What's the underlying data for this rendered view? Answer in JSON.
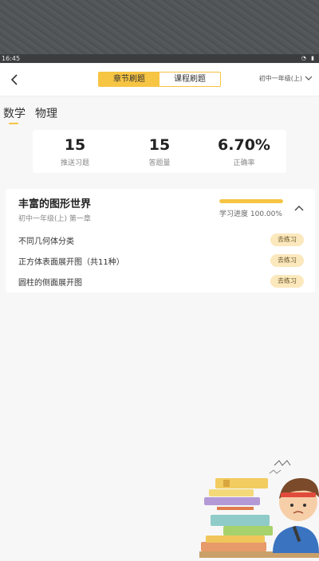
{
  "status_bar": {
    "time": "16:45",
    "icons": [
      "wifi-icon",
      "battery-icon"
    ]
  },
  "nav": {
    "tabs": [
      {
        "label": "章节刷题",
        "active": true
      },
      {
        "label": "课程刷题",
        "active": false
      }
    ],
    "grade_selector": "初中一年级(上)"
  },
  "subjects": [
    {
      "label": "数学",
      "active": true
    },
    {
      "label": "物理",
      "active": false
    }
  ],
  "stats": [
    {
      "value": "15",
      "label": "推送习题"
    },
    {
      "value": "15",
      "label": "答题量"
    },
    {
      "value": "6.70%",
      "label": "正确率"
    }
  ],
  "chapter": {
    "title": "丰富的图形世界",
    "subtitle": "初中一年级(上) 第一章",
    "progress_label": "学习进度 100.00%",
    "progress_percent": 100,
    "exercises": [
      {
        "name": "不同几何体分类",
        "action": "去练习"
      },
      {
        "name": "正方体表面展开图（共11种）",
        "action": "去练习"
      },
      {
        "name": "圆柱的侧面展开图",
        "action": "去练习"
      }
    ]
  },
  "colors": {
    "accent": "#f7c544",
    "accent_light": "#fbe8bd",
    "background": "#f7f7f7"
  }
}
